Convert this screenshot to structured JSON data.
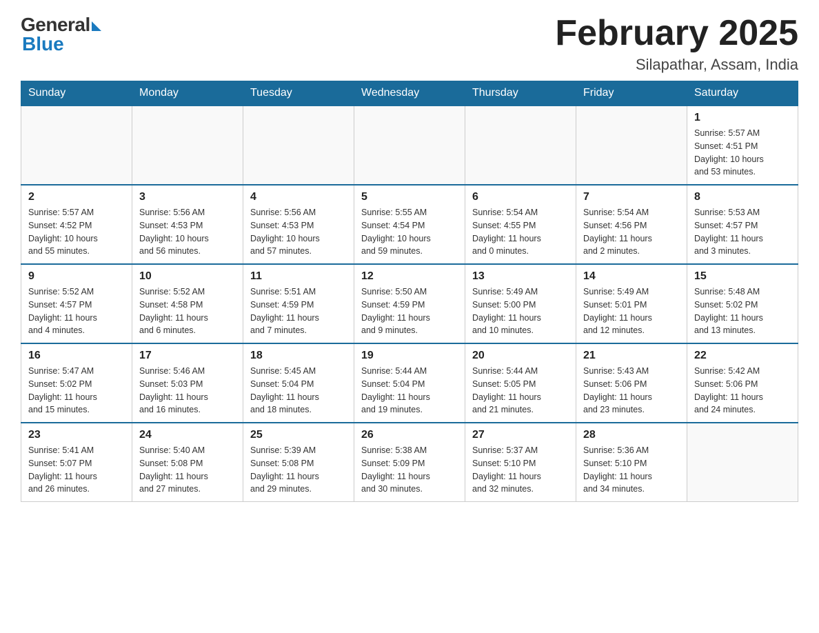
{
  "header": {
    "logo_general": "General",
    "logo_blue": "Blue",
    "month_title": "February 2025",
    "subtitle": "Silapathar, Assam, India"
  },
  "days_of_week": [
    "Sunday",
    "Monday",
    "Tuesday",
    "Wednesday",
    "Thursday",
    "Friday",
    "Saturday"
  ],
  "weeks": [
    [
      {
        "day": "",
        "info": ""
      },
      {
        "day": "",
        "info": ""
      },
      {
        "day": "",
        "info": ""
      },
      {
        "day": "",
        "info": ""
      },
      {
        "day": "",
        "info": ""
      },
      {
        "day": "",
        "info": ""
      },
      {
        "day": "1",
        "info": "Sunrise: 5:57 AM\nSunset: 4:51 PM\nDaylight: 10 hours\nand 53 minutes."
      }
    ],
    [
      {
        "day": "2",
        "info": "Sunrise: 5:57 AM\nSunset: 4:52 PM\nDaylight: 10 hours\nand 55 minutes."
      },
      {
        "day": "3",
        "info": "Sunrise: 5:56 AM\nSunset: 4:53 PM\nDaylight: 10 hours\nand 56 minutes."
      },
      {
        "day": "4",
        "info": "Sunrise: 5:56 AM\nSunset: 4:53 PM\nDaylight: 10 hours\nand 57 minutes."
      },
      {
        "day": "5",
        "info": "Sunrise: 5:55 AM\nSunset: 4:54 PM\nDaylight: 10 hours\nand 59 minutes."
      },
      {
        "day": "6",
        "info": "Sunrise: 5:54 AM\nSunset: 4:55 PM\nDaylight: 11 hours\nand 0 minutes."
      },
      {
        "day": "7",
        "info": "Sunrise: 5:54 AM\nSunset: 4:56 PM\nDaylight: 11 hours\nand 2 minutes."
      },
      {
        "day": "8",
        "info": "Sunrise: 5:53 AM\nSunset: 4:57 PM\nDaylight: 11 hours\nand 3 minutes."
      }
    ],
    [
      {
        "day": "9",
        "info": "Sunrise: 5:52 AM\nSunset: 4:57 PM\nDaylight: 11 hours\nand 4 minutes."
      },
      {
        "day": "10",
        "info": "Sunrise: 5:52 AM\nSunset: 4:58 PM\nDaylight: 11 hours\nand 6 minutes."
      },
      {
        "day": "11",
        "info": "Sunrise: 5:51 AM\nSunset: 4:59 PM\nDaylight: 11 hours\nand 7 minutes."
      },
      {
        "day": "12",
        "info": "Sunrise: 5:50 AM\nSunset: 4:59 PM\nDaylight: 11 hours\nand 9 minutes."
      },
      {
        "day": "13",
        "info": "Sunrise: 5:49 AM\nSunset: 5:00 PM\nDaylight: 11 hours\nand 10 minutes."
      },
      {
        "day": "14",
        "info": "Sunrise: 5:49 AM\nSunset: 5:01 PM\nDaylight: 11 hours\nand 12 minutes."
      },
      {
        "day": "15",
        "info": "Sunrise: 5:48 AM\nSunset: 5:02 PM\nDaylight: 11 hours\nand 13 minutes."
      }
    ],
    [
      {
        "day": "16",
        "info": "Sunrise: 5:47 AM\nSunset: 5:02 PM\nDaylight: 11 hours\nand 15 minutes."
      },
      {
        "day": "17",
        "info": "Sunrise: 5:46 AM\nSunset: 5:03 PM\nDaylight: 11 hours\nand 16 minutes."
      },
      {
        "day": "18",
        "info": "Sunrise: 5:45 AM\nSunset: 5:04 PM\nDaylight: 11 hours\nand 18 minutes."
      },
      {
        "day": "19",
        "info": "Sunrise: 5:44 AM\nSunset: 5:04 PM\nDaylight: 11 hours\nand 19 minutes."
      },
      {
        "day": "20",
        "info": "Sunrise: 5:44 AM\nSunset: 5:05 PM\nDaylight: 11 hours\nand 21 minutes."
      },
      {
        "day": "21",
        "info": "Sunrise: 5:43 AM\nSunset: 5:06 PM\nDaylight: 11 hours\nand 23 minutes."
      },
      {
        "day": "22",
        "info": "Sunrise: 5:42 AM\nSunset: 5:06 PM\nDaylight: 11 hours\nand 24 minutes."
      }
    ],
    [
      {
        "day": "23",
        "info": "Sunrise: 5:41 AM\nSunset: 5:07 PM\nDaylight: 11 hours\nand 26 minutes."
      },
      {
        "day": "24",
        "info": "Sunrise: 5:40 AM\nSunset: 5:08 PM\nDaylight: 11 hours\nand 27 minutes."
      },
      {
        "day": "25",
        "info": "Sunrise: 5:39 AM\nSunset: 5:08 PM\nDaylight: 11 hours\nand 29 minutes."
      },
      {
        "day": "26",
        "info": "Sunrise: 5:38 AM\nSunset: 5:09 PM\nDaylight: 11 hours\nand 30 minutes."
      },
      {
        "day": "27",
        "info": "Sunrise: 5:37 AM\nSunset: 5:10 PM\nDaylight: 11 hours\nand 32 minutes."
      },
      {
        "day": "28",
        "info": "Sunrise: 5:36 AM\nSunset: 5:10 PM\nDaylight: 11 hours\nand 34 minutes."
      },
      {
        "day": "",
        "info": ""
      }
    ]
  ]
}
